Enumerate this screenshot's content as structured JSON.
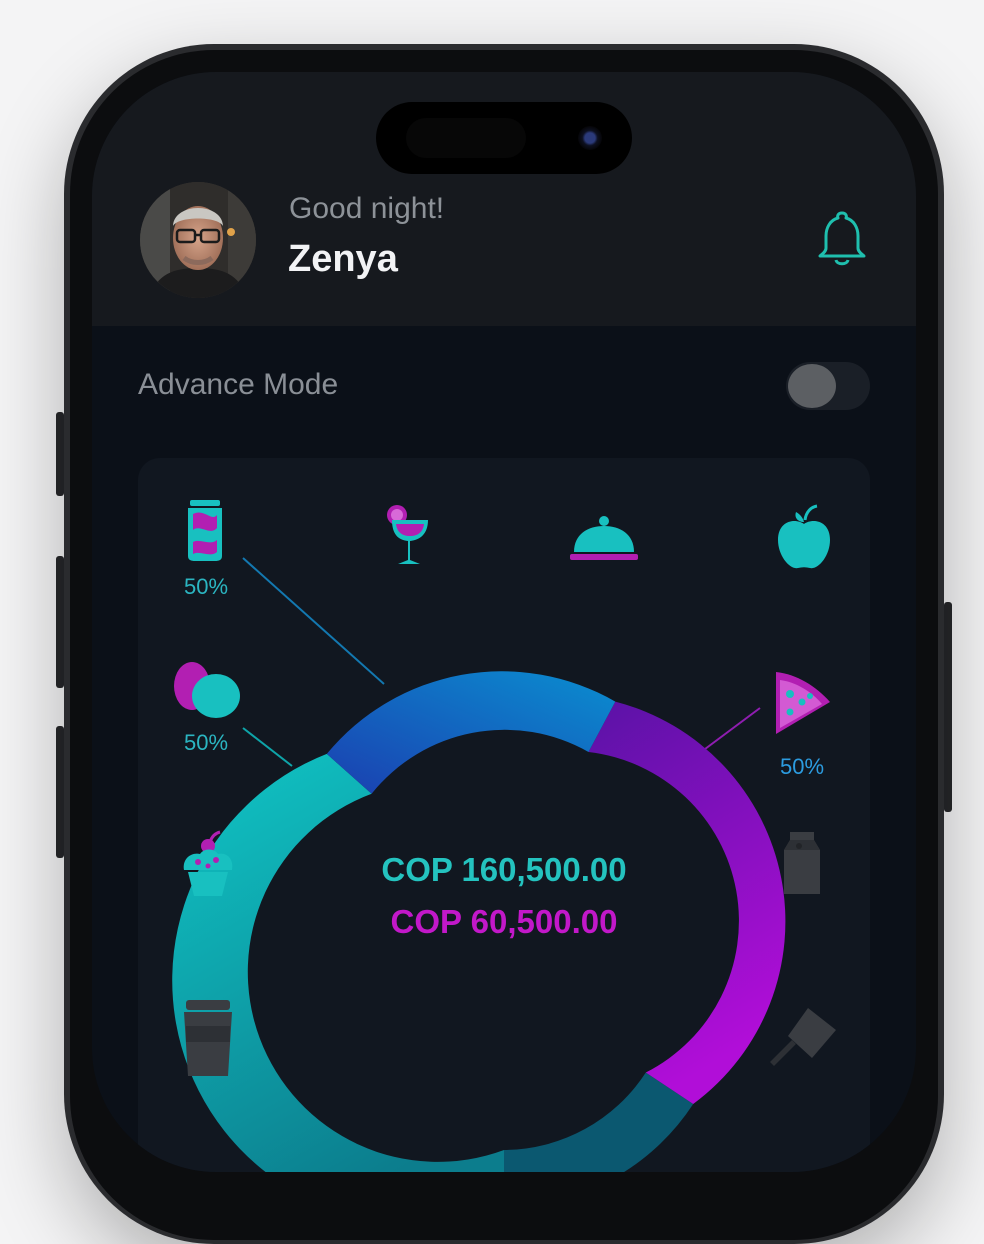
{
  "header": {
    "greeting": "Good night!",
    "user_name": "Zenya",
    "avatar": "user-avatar-photo",
    "notification_icon": "bell-icon"
  },
  "settings": {
    "advance_mode_label": "Advance Mode",
    "advance_mode_enabled": false
  },
  "budget": {
    "total_primary": "COP 160,500.00",
    "total_secondary": "COP 60,500.00",
    "categories": [
      {
        "icon": "soda-can-icon",
        "percent": "50%"
      },
      {
        "icon": "cocktail-icon"
      },
      {
        "icon": "food-cloche-icon"
      },
      {
        "icon": "apple-icon"
      },
      {
        "icon": "eggs-icon",
        "percent": "50%"
      },
      {
        "icon": "pizza-slice-icon",
        "percent": "50%"
      },
      {
        "icon": "cupcake-icon"
      },
      {
        "icon": "milk-carton-icon"
      },
      {
        "icon": "coffee-cup-icon"
      },
      {
        "icon": "cleaver-icon"
      }
    ]
  },
  "colors": {
    "teal": "#17c4c4",
    "magenta": "#b11bc6",
    "blue": "#1f5fc8",
    "background": "#0b1018"
  }
}
